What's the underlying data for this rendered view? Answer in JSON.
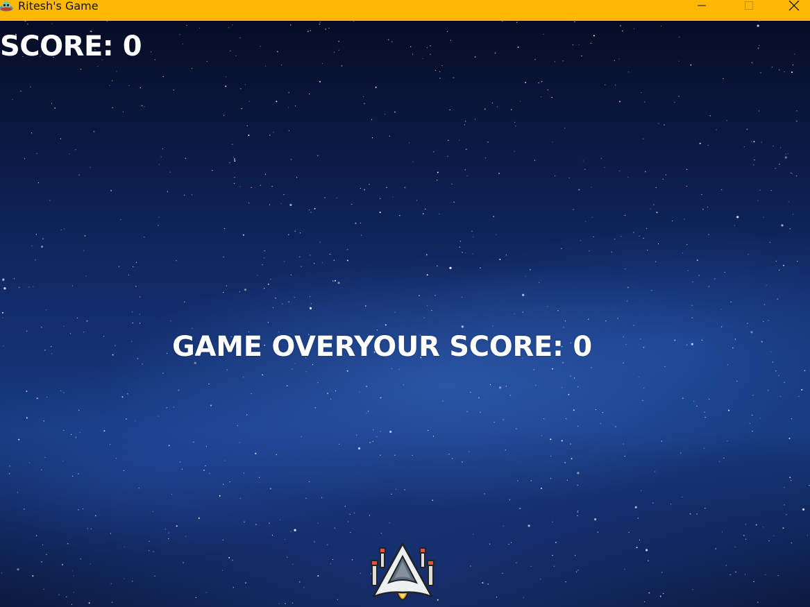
{
  "window": {
    "title": "Ritesh's Game",
    "titlebar_color": "#FFB902",
    "app_icon": "alien-ufo-icon",
    "controls": {
      "minimize_icon": "minimize-icon",
      "maximize_icon": "maximize-icon",
      "close_icon": "close-icon"
    }
  },
  "hud": {
    "score_text": "SCORE: 0"
  },
  "game_over": {
    "title": "GAME OVER",
    "your_score_text": "YOUR SCORE: 0"
  },
  "player": {
    "sprite": "spaceship-icon"
  },
  "background": {
    "description_colors": [
      "#060c24",
      "#132d6c",
      "#17397f"
    ]
  }
}
